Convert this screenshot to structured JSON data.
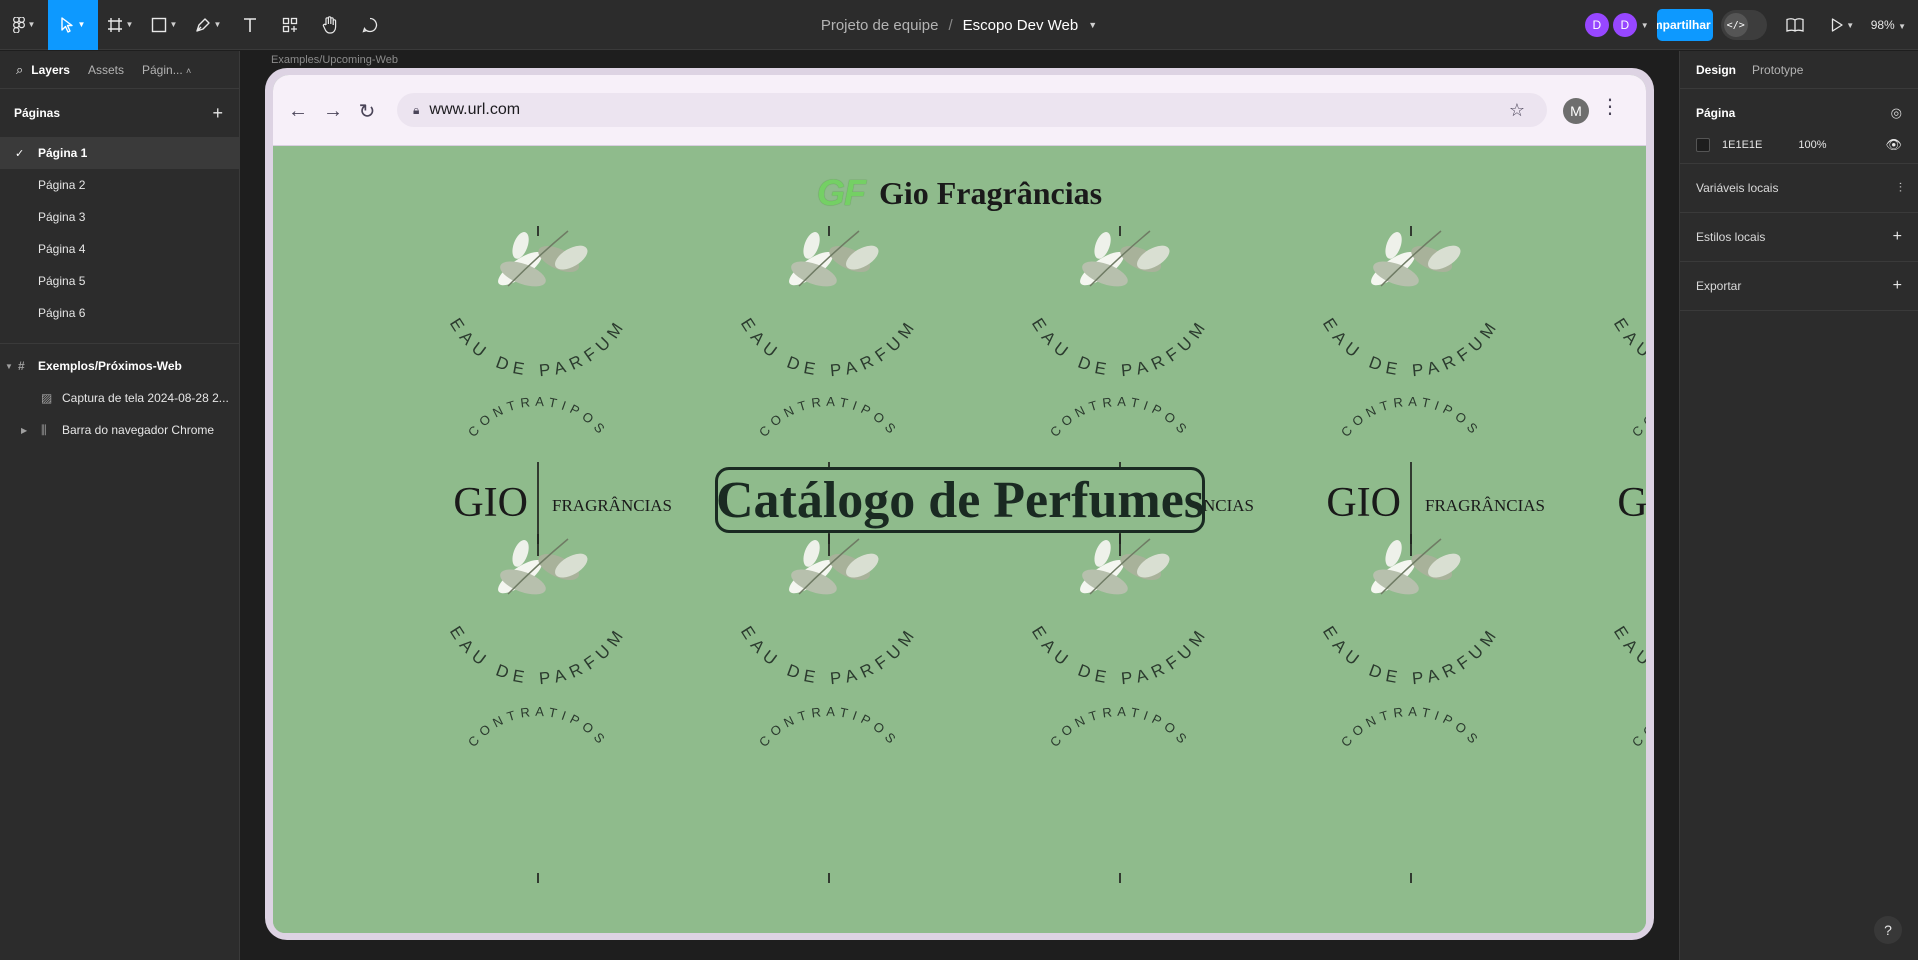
{
  "toolbar": {
    "team": "Projeto de equipe",
    "separator": "/",
    "file_name": "Escopo Dev Web",
    "avatars": [
      "D",
      "D"
    ],
    "share_label": "Compartilhar",
    "dev_mode_icon": "</>",
    "zoom": "98%"
  },
  "left_panel": {
    "tabs": [
      "Layers",
      "Assets",
      "Págin..."
    ],
    "pages_title": "Páginas",
    "pages": [
      "Página 1",
      "Página 2",
      "Página 3",
      "Página 4",
      "Página 5",
      "Página 6"
    ],
    "selected_page": "Página 1",
    "frame_name": "Exemplos/Próximos-Web",
    "layers": [
      "Captura de tela 2024-08-28 2...",
      "Barra do navegador Chrome"
    ]
  },
  "canvas": {
    "frame_label": "Examples/Upcoming-Web",
    "url": "www.url.com",
    "profile_initial": "M",
    "brand_logo": "GF",
    "brand_name": "Gio Fragrâncias",
    "catalog_title": "Catálogo de Perfumes",
    "pattern": {
      "eau": "EAU DE PARFUM",
      "contratipos": "CONTRATIPOS",
      "gio": "GIO",
      "fragrancias": "FRAGRÂNCIAS"
    }
  },
  "right_panel": {
    "tabs": [
      "Design",
      "Prototype"
    ],
    "page_section_title": "Página",
    "fill_hex": "1E1E1E",
    "fill_opacity": "100%",
    "local_variables": "Variáveis locais",
    "local_styles": "Estilos locais",
    "export": "Exportar",
    "help": "?"
  },
  "colors": {
    "accent": "#0d99ff",
    "avatar": "#9747ff",
    "site_bg": "#8fbb8c",
    "logo_green": "#74d064"
  }
}
